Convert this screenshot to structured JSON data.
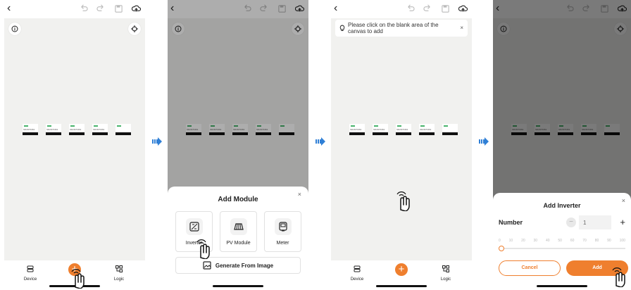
{
  "nav": {
    "device_label": "Device",
    "logic_label": "Logic"
  },
  "device_serials": [
    "SD2D70461",
    "SD2D70461",
    "SD2D70461",
    "SD2D70461",
    ""
  ],
  "add_module_sheet": {
    "title": "Add Module",
    "close": "×",
    "modules": [
      {
        "label": "Inverter",
        "icon": "inverter-icon"
      },
      {
        "label": "PV Module",
        "icon": "pv-module-icon"
      },
      {
        "label": "Meter",
        "icon": "meter-icon"
      }
    ],
    "generate_label": "Generate From Image"
  },
  "tip": {
    "text": "Please click on the blank area of the canvas to add",
    "close": "×"
  },
  "add_inverter_sheet": {
    "title": "Add Inverter",
    "close": "×",
    "number_label": "Number",
    "minus": "−",
    "value": "1",
    "plus": "+",
    "ticks": [
      "0",
      "10",
      "20",
      "30",
      "40",
      "50",
      "60",
      "70",
      "80",
      "90",
      "100"
    ],
    "slider_value": 1,
    "cancel_label": "Cancel",
    "add_label": "Add"
  },
  "colors": {
    "accent": "#ef7f2e",
    "canvas": "#f1f1ef",
    "arrow": "#2f7fd6"
  }
}
